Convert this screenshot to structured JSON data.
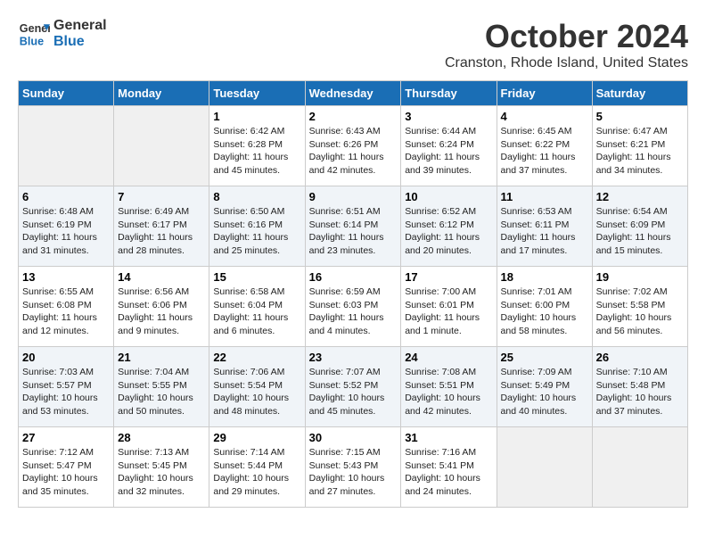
{
  "header": {
    "logo_line1": "General",
    "logo_line2": "Blue",
    "month_title": "October 2024",
    "location": "Cranston, Rhode Island, United States"
  },
  "weekdays": [
    "Sunday",
    "Monday",
    "Tuesday",
    "Wednesday",
    "Thursday",
    "Friday",
    "Saturday"
  ],
  "weeks": [
    [
      {
        "day": "",
        "empty": true
      },
      {
        "day": "",
        "empty": true
      },
      {
        "day": "1",
        "sunrise": "6:42 AM",
        "sunset": "6:28 PM",
        "daylight": "11 hours and 45 minutes."
      },
      {
        "day": "2",
        "sunrise": "6:43 AM",
        "sunset": "6:26 PM",
        "daylight": "11 hours and 42 minutes."
      },
      {
        "day": "3",
        "sunrise": "6:44 AM",
        "sunset": "6:24 PM",
        "daylight": "11 hours and 39 minutes."
      },
      {
        "day": "4",
        "sunrise": "6:45 AM",
        "sunset": "6:22 PM",
        "daylight": "11 hours and 37 minutes."
      },
      {
        "day": "5",
        "sunrise": "6:47 AM",
        "sunset": "6:21 PM",
        "daylight": "11 hours and 34 minutes."
      }
    ],
    [
      {
        "day": "6",
        "sunrise": "6:48 AM",
        "sunset": "6:19 PM",
        "daylight": "11 hours and 31 minutes."
      },
      {
        "day": "7",
        "sunrise": "6:49 AM",
        "sunset": "6:17 PM",
        "daylight": "11 hours and 28 minutes."
      },
      {
        "day": "8",
        "sunrise": "6:50 AM",
        "sunset": "6:16 PM",
        "daylight": "11 hours and 25 minutes."
      },
      {
        "day": "9",
        "sunrise": "6:51 AM",
        "sunset": "6:14 PM",
        "daylight": "11 hours and 23 minutes."
      },
      {
        "day": "10",
        "sunrise": "6:52 AM",
        "sunset": "6:12 PM",
        "daylight": "11 hours and 20 minutes."
      },
      {
        "day": "11",
        "sunrise": "6:53 AM",
        "sunset": "6:11 PM",
        "daylight": "11 hours and 17 minutes."
      },
      {
        "day": "12",
        "sunrise": "6:54 AM",
        "sunset": "6:09 PM",
        "daylight": "11 hours and 15 minutes."
      }
    ],
    [
      {
        "day": "13",
        "sunrise": "6:55 AM",
        "sunset": "6:08 PM",
        "daylight": "11 hours and 12 minutes."
      },
      {
        "day": "14",
        "sunrise": "6:56 AM",
        "sunset": "6:06 PM",
        "daylight": "11 hours and 9 minutes."
      },
      {
        "day": "15",
        "sunrise": "6:58 AM",
        "sunset": "6:04 PM",
        "daylight": "11 hours and 6 minutes."
      },
      {
        "day": "16",
        "sunrise": "6:59 AM",
        "sunset": "6:03 PM",
        "daylight": "11 hours and 4 minutes."
      },
      {
        "day": "17",
        "sunrise": "7:00 AM",
        "sunset": "6:01 PM",
        "daylight": "11 hours and 1 minute."
      },
      {
        "day": "18",
        "sunrise": "7:01 AM",
        "sunset": "6:00 PM",
        "daylight": "10 hours and 58 minutes."
      },
      {
        "day": "19",
        "sunrise": "7:02 AM",
        "sunset": "5:58 PM",
        "daylight": "10 hours and 56 minutes."
      }
    ],
    [
      {
        "day": "20",
        "sunrise": "7:03 AM",
        "sunset": "5:57 PM",
        "daylight": "10 hours and 53 minutes."
      },
      {
        "day": "21",
        "sunrise": "7:04 AM",
        "sunset": "5:55 PM",
        "daylight": "10 hours and 50 minutes."
      },
      {
        "day": "22",
        "sunrise": "7:06 AM",
        "sunset": "5:54 PM",
        "daylight": "10 hours and 48 minutes."
      },
      {
        "day": "23",
        "sunrise": "7:07 AM",
        "sunset": "5:52 PM",
        "daylight": "10 hours and 45 minutes."
      },
      {
        "day": "24",
        "sunrise": "7:08 AM",
        "sunset": "5:51 PM",
        "daylight": "10 hours and 42 minutes."
      },
      {
        "day": "25",
        "sunrise": "7:09 AM",
        "sunset": "5:49 PM",
        "daylight": "10 hours and 40 minutes."
      },
      {
        "day": "26",
        "sunrise": "7:10 AM",
        "sunset": "5:48 PM",
        "daylight": "10 hours and 37 minutes."
      }
    ],
    [
      {
        "day": "27",
        "sunrise": "7:12 AM",
        "sunset": "5:47 PM",
        "daylight": "10 hours and 35 minutes."
      },
      {
        "day": "28",
        "sunrise": "7:13 AM",
        "sunset": "5:45 PM",
        "daylight": "10 hours and 32 minutes."
      },
      {
        "day": "29",
        "sunrise": "7:14 AM",
        "sunset": "5:44 PM",
        "daylight": "10 hours and 29 minutes."
      },
      {
        "day": "30",
        "sunrise": "7:15 AM",
        "sunset": "5:43 PM",
        "daylight": "10 hours and 27 minutes."
      },
      {
        "day": "31",
        "sunrise": "7:16 AM",
        "sunset": "5:41 PM",
        "daylight": "10 hours and 24 minutes."
      },
      {
        "day": "",
        "empty": true
      },
      {
        "day": "",
        "empty": true
      }
    ]
  ],
  "labels": {
    "sunrise": "Sunrise:",
    "sunset": "Sunset:",
    "daylight": "Daylight:"
  }
}
